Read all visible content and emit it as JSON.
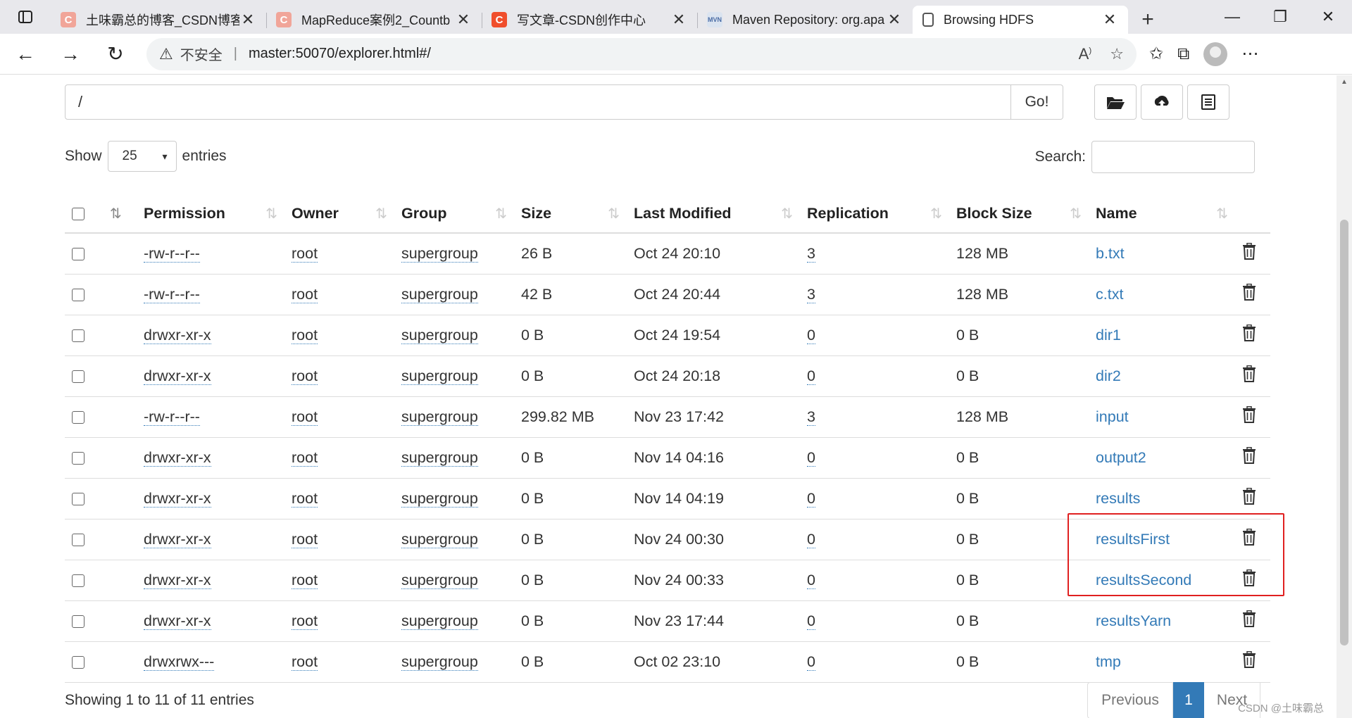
{
  "browser": {
    "tabs": [
      {
        "title": "土味霸总的博客_CSDN博客",
        "favicon": "csdn-light"
      },
      {
        "title": "MapReduce案例2_Countb",
        "favicon": "csdn-light"
      },
      {
        "title": "写文章-CSDN创作中心",
        "favicon": "csdn"
      },
      {
        "title": "Maven Repository: org.apa",
        "favicon": "mvn"
      },
      {
        "title": "Browsing HDFS",
        "favicon": "doc",
        "active": true
      }
    ],
    "favicon_mvn_text": "MVN",
    "favicon_csdn_text": "C",
    "new_tab": "+",
    "insecure_label": "不安全",
    "address_separator": "|",
    "url": "master:50070/explorer.html#/"
  },
  "explorer": {
    "path_value": "/",
    "go_label": "Go!",
    "show_label": "Show",
    "entries_select_value": "25",
    "entries_label": "entries",
    "search_label": "Search:",
    "search_value": ""
  },
  "table": {
    "columns": [
      "Permission",
      "Owner",
      "Group",
      "Size",
      "Last Modified",
      "Replication",
      "Block Size",
      "Name"
    ],
    "rows": [
      {
        "permission": "-rw-r--r--",
        "owner": "root",
        "group": "supergroup",
        "size": "26 B",
        "modified": "Oct 24 20:10",
        "replication": "3",
        "block_size": "128 MB",
        "name": "b.txt"
      },
      {
        "permission": "-rw-r--r--",
        "owner": "root",
        "group": "supergroup",
        "size": "42 B",
        "modified": "Oct 24 20:44",
        "replication": "3",
        "block_size": "128 MB",
        "name": "c.txt"
      },
      {
        "permission": "drwxr-xr-x",
        "owner": "root",
        "group": "supergroup",
        "size": "0 B",
        "modified": "Oct 24 19:54",
        "replication": "0",
        "block_size": "0 B",
        "name": "dir1"
      },
      {
        "permission": "drwxr-xr-x",
        "owner": "root",
        "group": "supergroup",
        "size": "0 B",
        "modified": "Oct 24 20:18",
        "replication": "0",
        "block_size": "0 B",
        "name": "dir2"
      },
      {
        "permission": "-rw-r--r--",
        "owner": "root",
        "group": "supergroup",
        "size": "299.82 MB",
        "modified": "Nov 23 17:42",
        "replication": "3",
        "block_size": "128 MB",
        "name": "input"
      },
      {
        "permission": "drwxr-xr-x",
        "owner": "root",
        "group": "supergroup",
        "size": "0 B",
        "modified": "Nov 14 04:16",
        "replication": "0",
        "block_size": "0 B",
        "name": "output2"
      },
      {
        "permission": "drwxr-xr-x",
        "owner": "root",
        "group": "supergroup",
        "size": "0 B",
        "modified": "Nov 14 04:19",
        "replication": "0",
        "block_size": "0 B",
        "name": "results"
      },
      {
        "permission": "drwxr-xr-x",
        "owner": "root",
        "group": "supergroup",
        "size": "0 B",
        "modified": "Nov 24 00:30",
        "replication": "0",
        "block_size": "0 B",
        "name": "resultsFirst"
      },
      {
        "permission": "drwxr-xr-x",
        "owner": "root",
        "group": "supergroup",
        "size": "0 B",
        "modified": "Nov 24 00:33",
        "replication": "0",
        "block_size": "0 B",
        "name": "resultsSecond"
      },
      {
        "permission": "drwxr-xr-x",
        "owner": "root",
        "group": "supergroup",
        "size": "0 B",
        "modified": "Nov 23 17:44",
        "replication": "0",
        "block_size": "0 B",
        "name": "resultsYarn"
      },
      {
        "permission": "drwxrwx---",
        "owner": "root",
        "group": "supergroup",
        "size": "0 B",
        "modified": "Oct 02 23:10",
        "replication": "0",
        "block_size": "0 B",
        "name": "tmp"
      }
    ],
    "highlighted_rows": [
      "resultsFirst",
      "resultsSecond"
    ]
  },
  "footer": {
    "info": "Showing 1 to 11 of 11 entries",
    "prev_label": "Previous",
    "current_page": "1",
    "next_label": "Next",
    "watermark": "CSDN @土味霸总"
  },
  "colors": {
    "link": "#337ab7",
    "highlight_border": "#e02020",
    "pager_active": "#337ab7"
  }
}
